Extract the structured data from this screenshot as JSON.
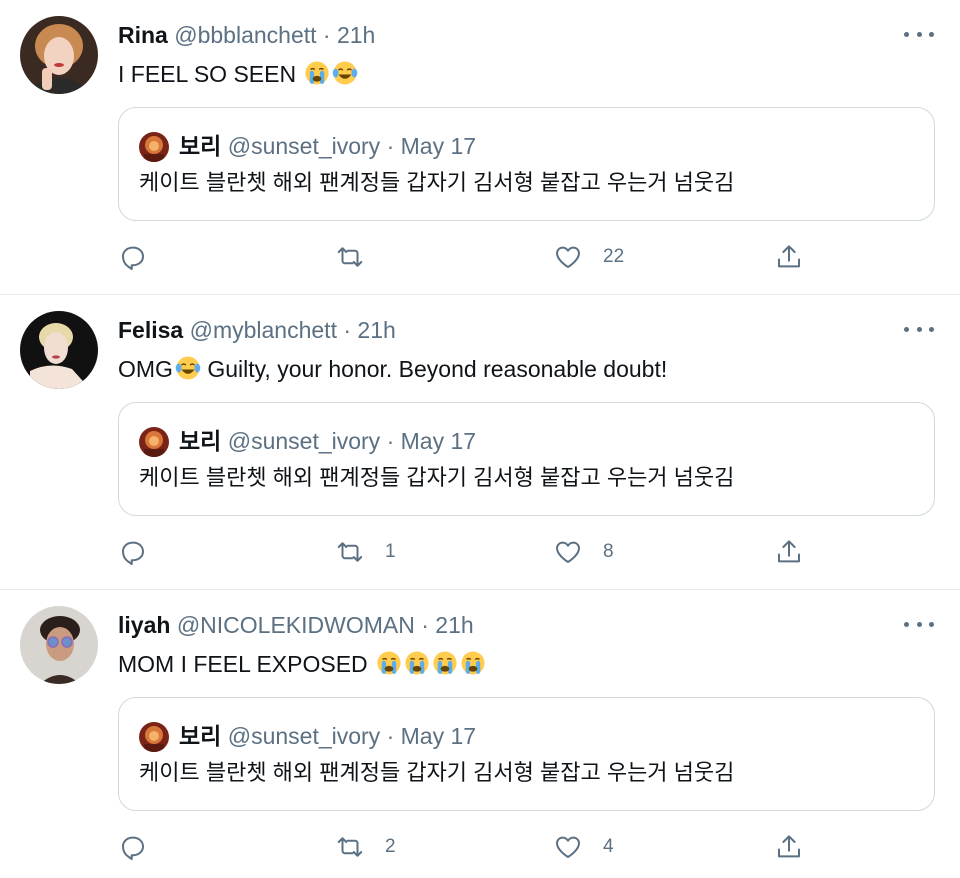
{
  "tweets": [
    {
      "name": "Rina",
      "handle": "@bbblanchett",
      "sep": "·",
      "time": "21h",
      "text": "I FEEL SO SEEN",
      "emojis": [
        "loudly-crying-face",
        "face-with-tears-of-joy"
      ],
      "quote": {
        "name": "보리",
        "handle": "@sunset_ivory",
        "sep": "·",
        "date": "May 17",
        "text": "케이트 블란쳇 해외 팬계정들 갑자기 김서형 붙잡고 우는거 넘웃김"
      },
      "replies": "",
      "retweets": "",
      "likes": "22"
    },
    {
      "name": "Felisa",
      "handle": "@myblanchett",
      "sep": "·",
      "time": "21h",
      "text_before": "OMG",
      "text_after": " Guilty, your honor. Beyond reasonable doubt!",
      "emojis": [
        "face-with-tears-of-joy"
      ],
      "quote": {
        "name": "보리",
        "handle": "@sunset_ivory",
        "sep": "·",
        "date": "May 17",
        "text": "케이트 블란쳇 해외 팬계정들 갑자기 김서형 붙잡고 우는거 넘웃김"
      },
      "replies": "",
      "retweets": "1",
      "likes": "8"
    },
    {
      "name": "liyah",
      "handle": "@NICOLEKIDWOMAN",
      "sep": "·",
      "time": "21h",
      "text": "MOM I FEEL EXPOSED",
      "emojis": [
        "loudly-crying-face",
        "loudly-crying-face",
        "loudly-crying-face",
        "loudly-crying-face"
      ],
      "quote": {
        "name": "보리",
        "handle": "@sunset_ivory",
        "sep": "·",
        "date": "May 17",
        "text": "케이트 블란쳇 해외 팬계정들 갑자기 김서형 붙잡고 우는거 넘웃김"
      },
      "replies": "",
      "retweets": "2",
      "likes": "4"
    }
  ],
  "colors": {
    "text": "#0f1419",
    "secondary": "#5b7083",
    "border": "#cfd9de",
    "divider": "#e6ecf0"
  }
}
